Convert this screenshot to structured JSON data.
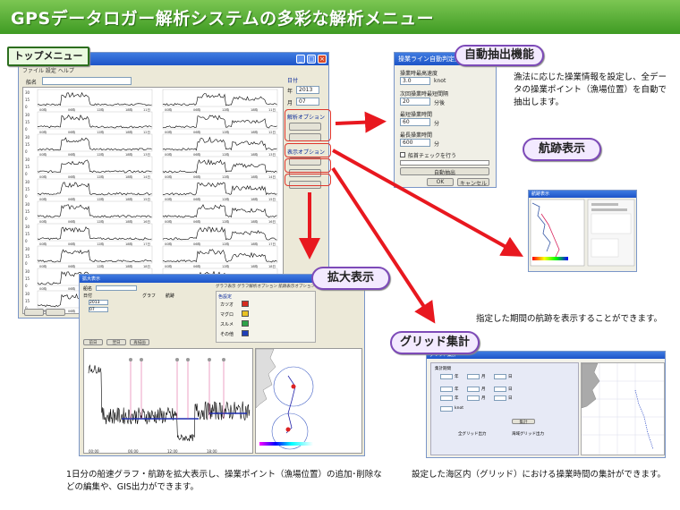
{
  "header": {
    "title": "GPSデータロガー解析システムの多彩な解析メニュー"
  },
  "callouts": {
    "top_menu": "トップメニュー",
    "auto_extract": "自動抽出機能",
    "track": "航跡表示",
    "zoom": "拡大表示",
    "grid": "グリッド集計"
  },
  "descriptions": {
    "auto_extract": "漁法に応じた操業情報を設定し、全データの操業ポイント（漁場位置）を自動で抽出します。",
    "track": "指定した期間の航跡を表示することができます。",
    "zoom": "1日分の船速グラフ・航跡を拡大表示し、操業ポイント（漁場位置）の追加･削除などの編集や、GIS出力ができます。",
    "grid": "設定した海区内（グリッド）における操業時間の集計ができます。"
  },
  "main_window": {
    "menu": "ファイル 設定 ヘルプ",
    "ship_label": "船名",
    "date_label": "日付",
    "year_label": "年",
    "year_value": "2013",
    "month_label": "月",
    "month_value": "07",
    "analysis_option": "解析オプション",
    "display_option": "表示オプション",
    "y_ticks": [
      "30",
      "15",
      "0"
    ],
    "x_ticks": [
      "00時",
      "06時",
      "12時",
      "18時"
    ],
    "dates": [
      "11日",
      "12日",
      "13日",
      "14日",
      "15日",
      "16日",
      "17日",
      "18日",
      "19日",
      "20日"
    ]
  },
  "extract_window": {
    "title": "操業ライン自動判定処理",
    "max_speed_label": "操業時最高速度",
    "max_speed_value": "3.0",
    "max_speed_unit": "knot",
    "interval_label": "次回操業時最短間隔",
    "interval_value": "20",
    "interval_unit": "分後",
    "min_time_label": "最短操業時間",
    "min_time_value": "60",
    "min_time_unit": "分",
    "max_time_label": "最長操業時間",
    "max_time_value": "600",
    "max_time_unit": "分",
    "check_label": "船首チェックを行う",
    "run_button": "自動抽出",
    "ok_button": "OK",
    "cancel_button": "キャンセル"
  },
  "zoom_window": {
    "title": "拡大表示",
    "ship_label": "船名",
    "date_label": "日付",
    "year_value": "2013",
    "month_value": "07",
    "graph_label": "グラフ",
    "track_label": "航跡",
    "tab1": "グラフ表示",
    "tab2": "グラフ解析オプション",
    "tab3": "航跡表示オプション",
    "legend_title": "色設定",
    "legend": [
      {
        "label": "カツオ",
        "color": "#d62c1f"
      },
      {
        "label": "マグロ",
        "color": "#e8c224"
      },
      {
        "label": "スルメ",
        "color": "#2ea24a"
      },
      {
        "label": "その他",
        "color": "#1f3fb8"
      }
    ],
    "buttons": [
      "前日",
      "翌日",
      "再描画"
    ],
    "x_ticks": [
      "00:00",
      "06:00",
      "12:00",
      "18:00"
    ]
  },
  "grid_window": {
    "title": "グリッド集計",
    "period_label": "集計期間",
    "year_label": "年",
    "month_label": "月",
    "day_label": "日",
    "knot_label": "knot",
    "run_button": "集計",
    "option_a": "全グリッド出力",
    "option_b": "海域グリッド出力"
  },
  "track_window": {
    "title": "航跡表示"
  }
}
